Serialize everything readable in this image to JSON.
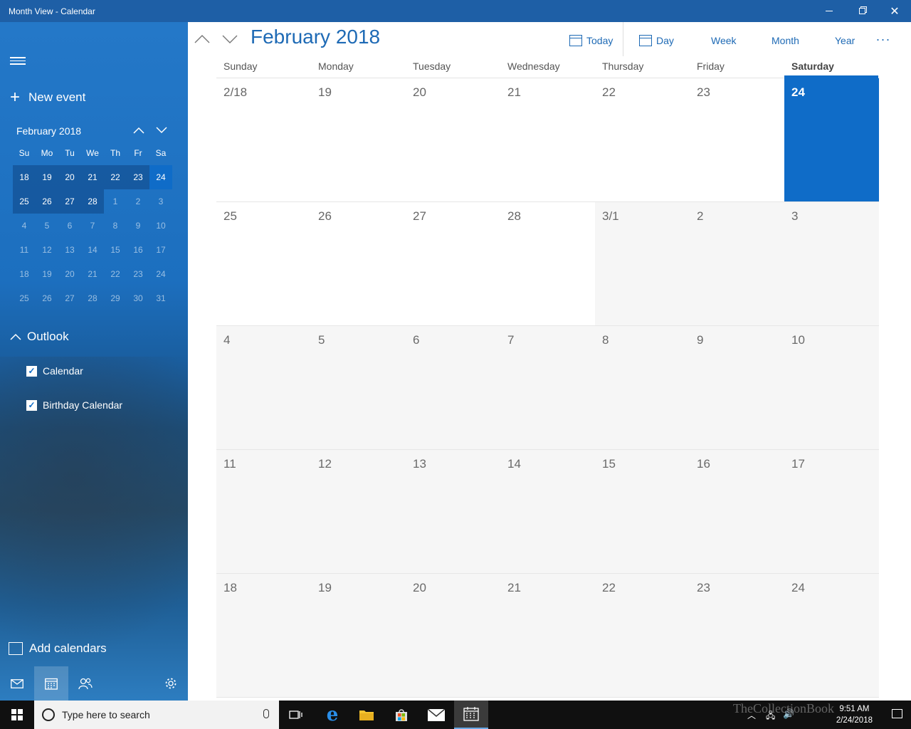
{
  "window": {
    "title": "Month View - Calendar"
  },
  "sidebar": {
    "new_event": "New event",
    "mini": {
      "title": "February 2018",
      "weekdays": [
        "Su",
        "Mo",
        "Tu",
        "We",
        "Th",
        "Fr",
        "Sa"
      ],
      "weeks": [
        [
          [
            "18",
            "in"
          ],
          [
            "19",
            "in"
          ],
          [
            "20",
            "in"
          ],
          [
            "21",
            "in"
          ],
          [
            "22",
            "in"
          ],
          [
            "23",
            "in"
          ],
          [
            "24",
            "today"
          ]
        ],
        [
          [
            "25",
            "in"
          ],
          [
            "26",
            "in"
          ],
          [
            "27",
            "in"
          ],
          [
            "28",
            "in"
          ],
          [
            "1",
            "out"
          ],
          [
            "2",
            "out"
          ],
          [
            "3",
            "out"
          ]
        ],
        [
          [
            "4",
            "out"
          ],
          [
            "5",
            "out"
          ],
          [
            "6",
            "out"
          ],
          [
            "7",
            "out"
          ],
          [
            "8",
            "out"
          ],
          [
            "9",
            "out"
          ],
          [
            "10",
            "out"
          ]
        ],
        [
          [
            "11",
            "out"
          ],
          [
            "12",
            "out"
          ],
          [
            "13",
            "out"
          ],
          [
            "14",
            "out"
          ],
          [
            "15",
            "out"
          ],
          [
            "16",
            "out"
          ],
          [
            "17",
            "out"
          ]
        ],
        [
          [
            "18",
            "out"
          ],
          [
            "19",
            "out"
          ],
          [
            "20",
            "out"
          ],
          [
            "21",
            "out"
          ],
          [
            "22",
            "out"
          ],
          [
            "23",
            "out"
          ],
          [
            "24",
            "out"
          ]
        ],
        [
          [
            "25",
            "out"
          ],
          [
            "26",
            "out"
          ],
          [
            "27",
            "out"
          ],
          [
            "28",
            "out"
          ],
          [
            "29",
            "out"
          ],
          [
            "30",
            "out"
          ],
          [
            "31",
            "out"
          ]
        ]
      ]
    },
    "account": "Outlook",
    "calendars": [
      "Calendar",
      "Birthday Calendar"
    ],
    "add_calendars": "Add calendars"
  },
  "toolbar": {
    "month_title": "February 2018",
    "today": "Today",
    "day": "Day",
    "week": "Week",
    "month": "Month",
    "year": "Year",
    "more": "···"
  },
  "calendar": {
    "days": [
      "Sunday",
      "Monday",
      "Tuesday",
      "Wednesday",
      "Thursday",
      "Friday",
      "Saturday"
    ],
    "weeks": [
      [
        [
          "2/18",
          "cur"
        ],
        [
          "19",
          "cur"
        ],
        [
          "20",
          "cur"
        ],
        [
          "21",
          "cur"
        ],
        [
          "22",
          "cur"
        ],
        [
          "23",
          "cur"
        ],
        [
          "24",
          "today"
        ]
      ],
      [
        [
          "25",
          "cur"
        ],
        [
          "26",
          "cur"
        ],
        [
          "27",
          "cur"
        ],
        [
          "28",
          "cur"
        ],
        [
          "3/1",
          "oth"
        ],
        [
          "2",
          "oth"
        ],
        [
          "3",
          "oth"
        ]
      ],
      [
        [
          "4",
          "oth"
        ],
        [
          "5",
          "oth"
        ],
        [
          "6",
          "oth"
        ],
        [
          "7",
          "oth"
        ],
        [
          "8",
          "oth"
        ],
        [
          "9",
          "oth"
        ],
        [
          "10",
          "oth"
        ]
      ],
      [
        [
          "11",
          "oth"
        ],
        [
          "12",
          "oth"
        ],
        [
          "13",
          "oth"
        ],
        [
          "14",
          "oth"
        ],
        [
          "15",
          "oth"
        ],
        [
          "16",
          "oth"
        ],
        [
          "17",
          "oth"
        ]
      ],
      [
        [
          "18",
          "oth"
        ],
        [
          "19",
          "oth"
        ],
        [
          "20",
          "oth"
        ],
        [
          "21",
          "oth"
        ],
        [
          "22",
          "oth"
        ],
        [
          "23",
          "oth"
        ],
        [
          "24",
          "oth"
        ]
      ]
    ]
  },
  "taskbar": {
    "search_placeholder": "Type here to search",
    "time": "9:51 AM",
    "date": "2/24/2018"
  },
  "watermark": "TheCollectionBook"
}
